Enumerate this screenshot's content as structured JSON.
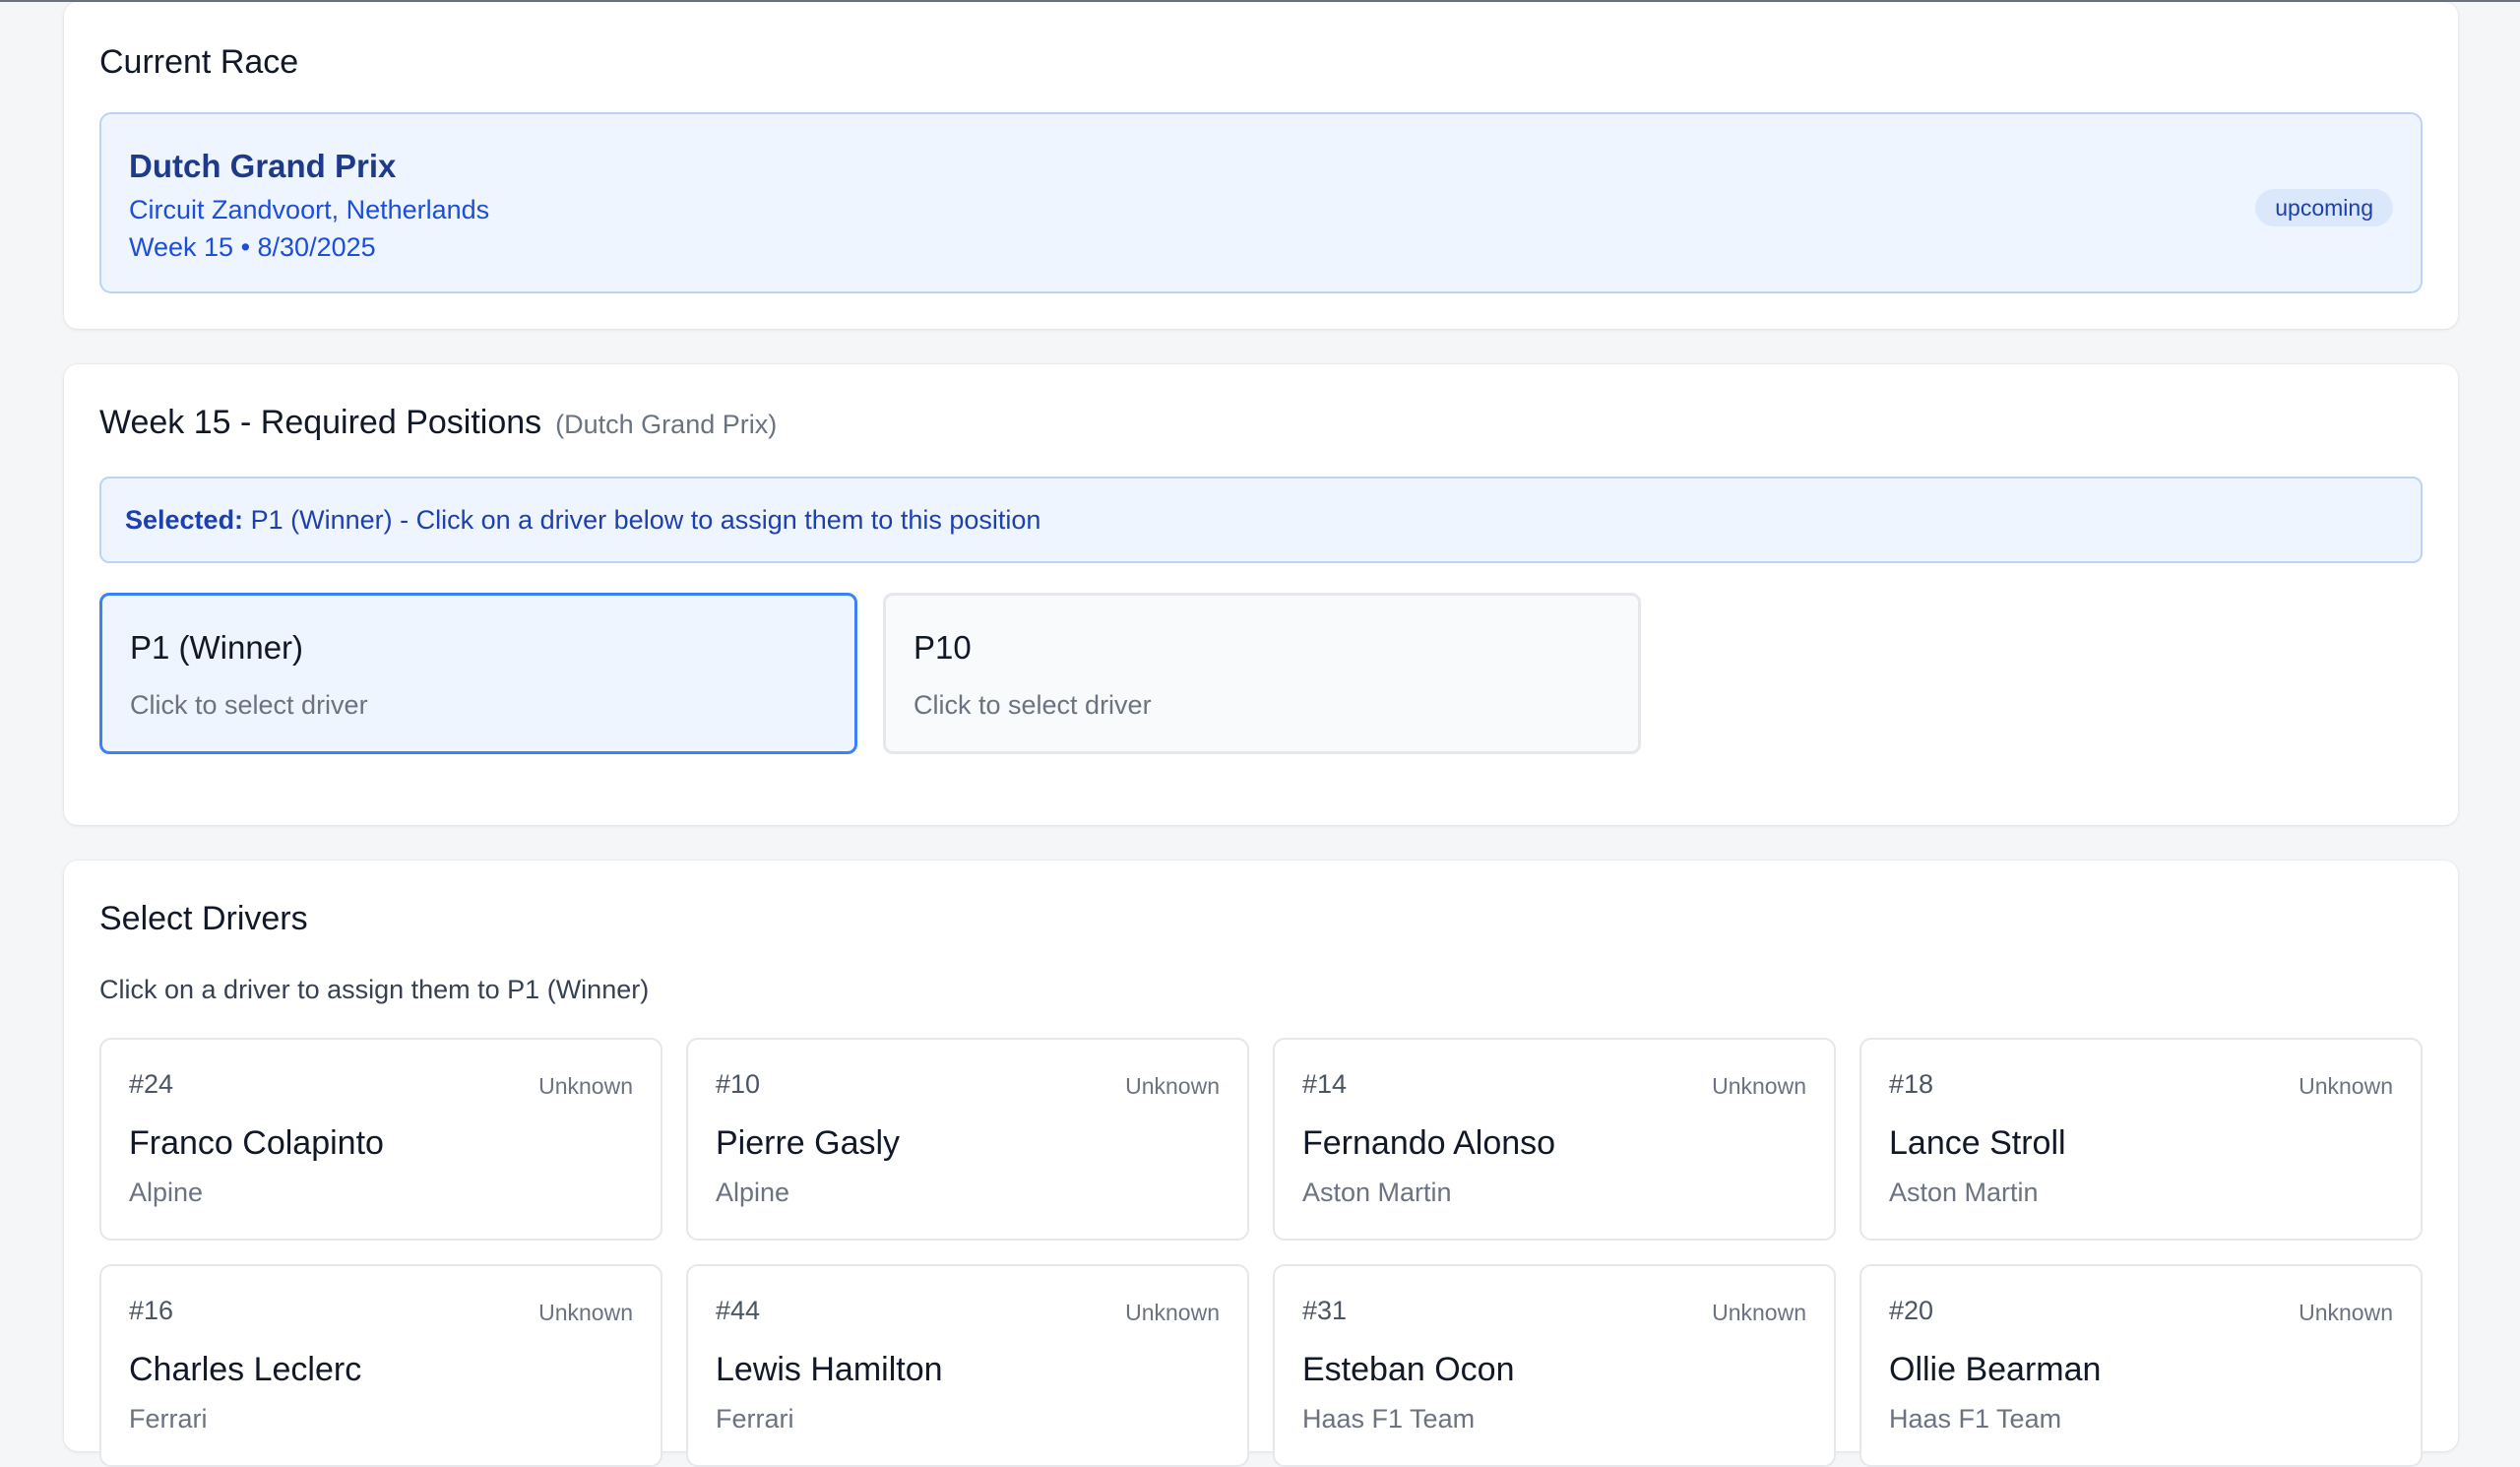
{
  "current_race": {
    "heading": "Current Race",
    "name": "Dutch Grand Prix",
    "circuit": "Circuit Zandvoort, Netherlands",
    "week_date": "Week 15 • 8/30/2025",
    "status": "upcoming"
  },
  "positions": {
    "heading": "Week 15 - Required Positions",
    "subheading": "(Dutch Grand Prix)",
    "selected_label": "Selected:",
    "selected_text": "P1 (Winner) - Click on a driver below to assign them to this position",
    "items": [
      {
        "label": "P1 (Winner)",
        "hint": "Click to select driver"
      },
      {
        "label": "P10",
        "hint": "Click to select driver"
      }
    ]
  },
  "drivers": {
    "heading": "Select Drivers",
    "hint": "Click on a driver to assign them to P1 (Winner)",
    "items": [
      {
        "number": "#24",
        "status": "Unknown",
        "name": "Franco Colapinto",
        "team": "Alpine"
      },
      {
        "number": "#10",
        "status": "Unknown",
        "name": "Pierre Gasly",
        "team": "Alpine"
      },
      {
        "number": "#14",
        "status": "Unknown",
        "name": "Fernando Alonso",
        "team": "Aston Martin"
      },
      {
        "number": "#18",
        "status": "Unknown",
        "name": "Lance Stroll",
        "team": "Aston Martin"
      },
      {
        "number": "#16",
        "status": "Unknown",
        "name": "Charles Leclerc",
        "team": "Ferrari"
      },
      {
        "number": "#44",
        "status": "Unknown",
        "name": "Lewis Hamilton",
        "team": "Ferrari"
      },
      {
        "number": "#31",
        "status": "Unknown",
        "name": "Esteban Ocon",
        "team": "Haas F1 Team"
      },
      {
        "number": "#20",
        "status": "Unknown",
        "name": "Ollie Bearman",
        "team": "Haas F1 Team"
      }
    ]
  }
}
